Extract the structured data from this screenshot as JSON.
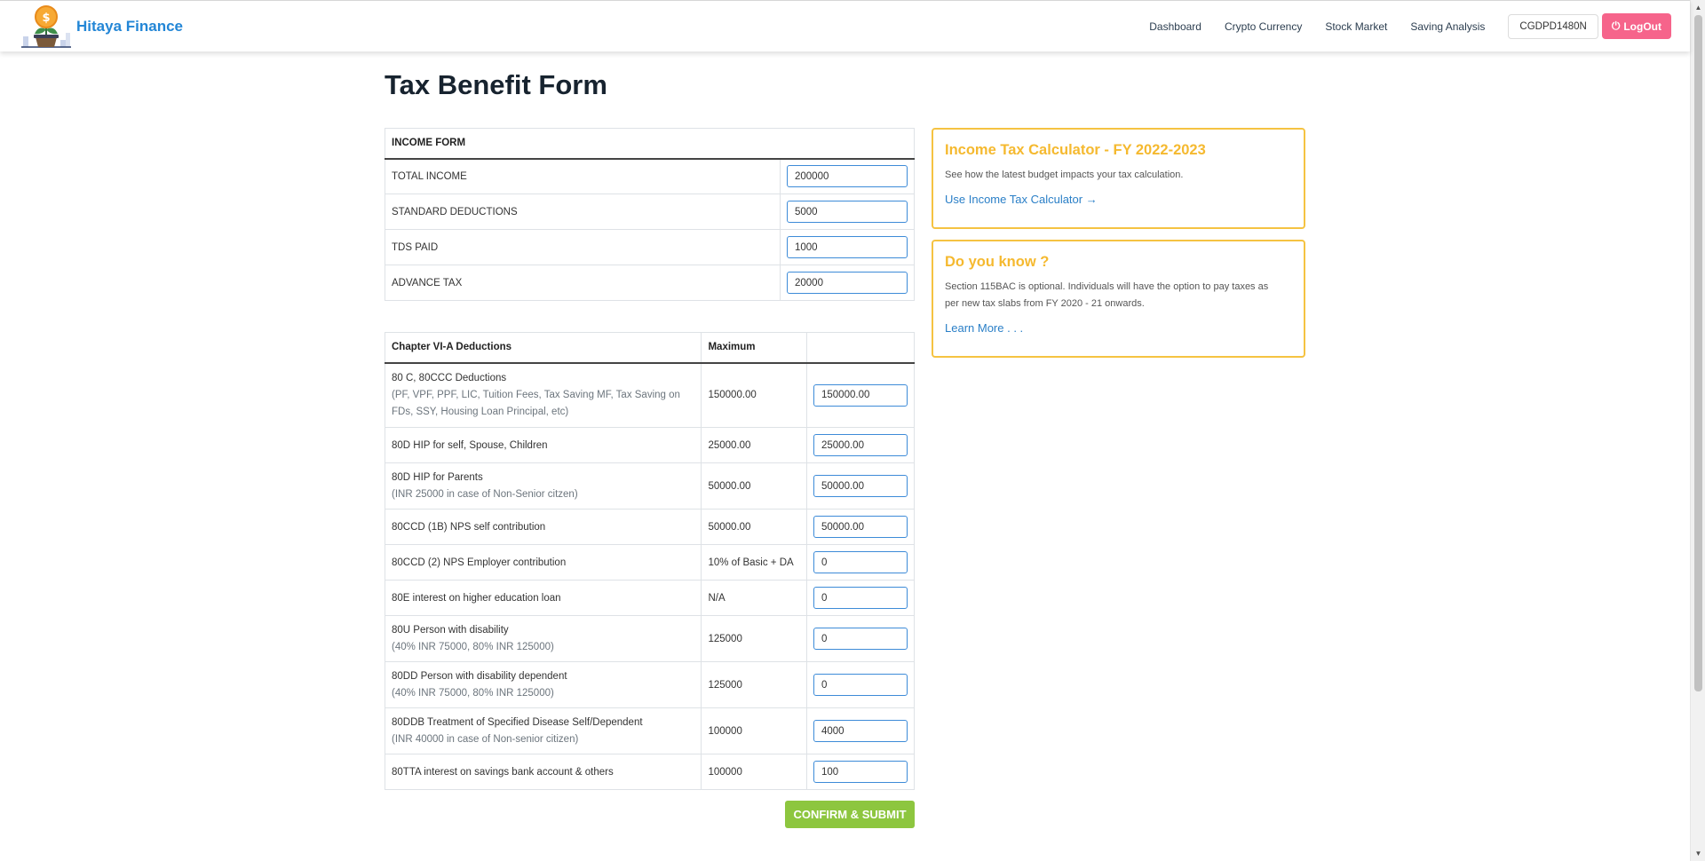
{
  "brand": {
    "name": "Hitaya Finance"
  },
  "nav": {
    "links": [
      "Dashboard",
      "Crypto Currency",
      "Stock Market",
      "Saving Analysis"
    ],
    "user_id": "CGDPD1480N",
    "logout_label": "LogOut"
  },
  "page": {
    "title": "Tax Benefit Form"
  },
  "income_form": {
    "header": "INCOME FORM",
    "rows": [
      {
        "label": "TOTAL INCOME",
        "value": "200000"
      },
      {
        "label": "STANDARD DEDUCTIONS",
        "value": "5000"
      },
      {
        "label": "TDS PAID",
        "value": "1000"
      },
      {
        "label": "ADVANCE TAX",
        "value": "20000"
      }
    ]
  },
  "deductions": {
    "headers": [
      "Chapter VI-A Deductions",
      "Maximum",
      ""
    ],
    "rows": [
      {
        "label": "80 C, 80CCC Deductions",
        "sub1": "(PF, VPF, PPF, LIC, Tuition Fees, Tax Saving MF, Tax Saving on",
        "sub2": "FDs, SSY, Housing Loan Principal, etc)",
        "max": "150000.00",
        "value": "150000.00"
      },
      {
        "label": "80D HIP for self, Spouse, Children",
        "max": "25000.00",
        "value": "25000.00"
      },
      {
        "label": "80D HIP for Parents",
        "sub1": "(INR 25000 in case of Non-Senior citzen)",
        "max": "50000.00",
        "value": "50000.00"
      },
      {
        "label": "80CCD (1B) NPS self contribution",
        "max": "50000.00",
        "value": "50000.00"
      },
      {
        "label": "80CCD (2) NPS Employer contribution",
        "max": "10% of Basic + DA",
        "value": "0"
      },
      {
        "label": "80E interest on higher education loan",
        "max": "N/A",
        "value": "0"
      },
      {
        "label": "80U Person with disability",
        "sub1": "(40% INR 75000, 80% INR 125000)",
        "max": "125000",
        "value": "0"
      },
      {
        "label": "80DD Person with disability dependent",
        "sub1": "(40% INR 75000, 80% INR 125000)",
        "max": "125000",
        "value": "0"
      },
      {
        "label": "80DDB Treatment of Specified Disease Self/Dependent",
        "sub1": "(INR 40000 in case of Non-senior citizen)",
        "max": "100000",
        "value": "4000"
      },
      {
        "label": "80TTA interest on savings bank account & others",
        "max": "100000",
        "value": "100"
      }
    ],
    "submit_label": "CONFIRM & SUBMIT"
  },
  "cards": {
    "calculator": {
      "title": "Income Tax Calculator - FY 2022-2023",
      "text": "See how the latest budget impacts your tax calculation.",
      "link": "Use Income Tax Calculator"
    },
    "did_you_know": {
      "title": "Do you know ?",
      "text1": "Section 115BAC is optional. Individuals will have the option to pay taxes as",
      "text2": "per new tax slabs from FY 2020 - 21 onwards.",
      "link": "Learn More . . ."
    }
  },
  "colors": {
    "brand": "#2386d6",
    "logout": "#f6648b",
    "submit": "#8dc63f",
    "card_accent": "#f5c342",
    "input_border": "#3d8bd8"
  }
}
